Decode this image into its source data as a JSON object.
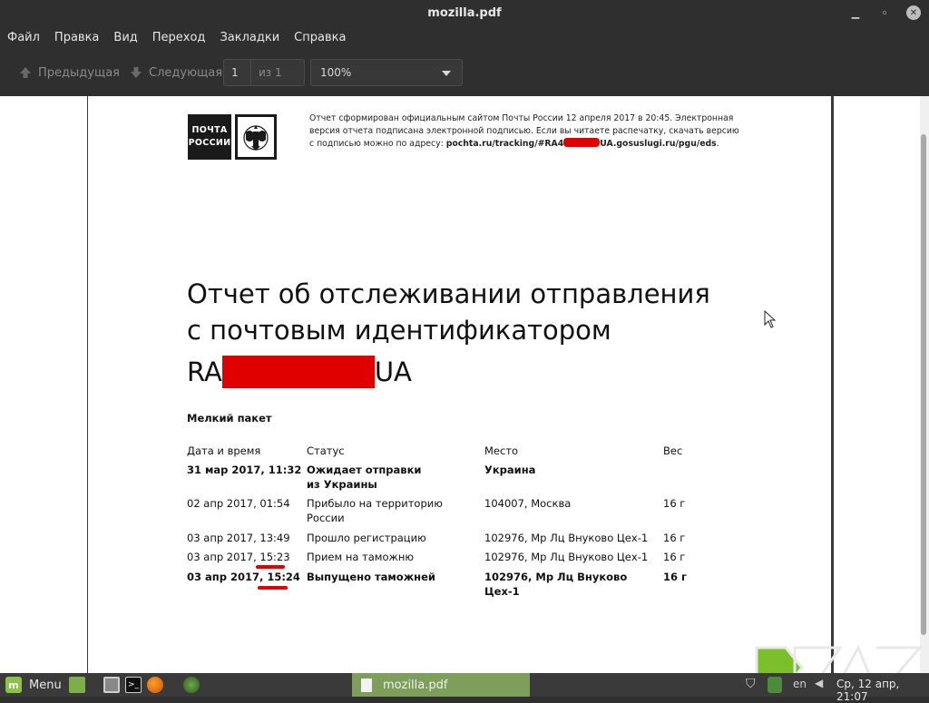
{
  "window": {
    "title": "mozilla.pdf"
  },
  "menubar": {
    "items": [
      "Файл",
      "Правка",
      "Вид",
      "Переход",
      "Закладки",
      "Справка"
    ]
  },
  "toolbar": {
    "prev_label": "Предыдущая",
    "next_label": "Следующая",
    "page_value": "1",
    "page_of": "из 1",
    "zoom_value": "100%"
  },
  "document": {
    "logo": {
      "line1": "ПОЧТА",
      "line2": "РОССИИ"
    },
    "notice": {
      "text1": "Отчет сформирован официальным сайтом Почты России 12 апреля 2017 в 20:45. Электронная версия отчета подписана электронной подписью. Если вы читаете распечатку, скачать версию с подписью можно по адресу: ",
      "url_start": "pochta.ru/tracking/#RA4",
      "url_end": "UA.gosuslugi.ru/pgu/eds",
      "text2": "."
    },
    "title_line1": "Отчет об отслеживании отправления",
    "title_line2": "с почтовым идентификатором",
    "tracking_prefix": "RA",
    "tracking_suffix": "UA",
    "parcel_type": "Мелкий пакет",
    "table": {
      "headers": {
        "date": "Дата и время",
        "status": "Статус",
        "place": "Место",
        "weight": "Вес"
      },
      "rows": [
        {
          "date": "31 мар 2017, 11:32",
          "status1": "Ожидает отправки",
          "status2": "из Украины",
          "place": "Украина",
          "weight": ""
        },
        {
          "date": "02 апр 2017, 01:54",
          "status1": "Прибыло на территорию",
          "status2": "России",
          "place": "104007, Москва",
          "weight": "16 г"
        },
        {
          "date": "03 апр 2017, 13:49",
          "status1": "Прошло регистрацию",
          "status2": "",
          "place": "102976, Мр Лц Внуково Цех-1",
          "weight": "16 г"
        },
        {
          "date": "03 апр 2017, 15:23",
          "status1": "Прием на таможню",
          "status2": "",
          "place": "102976, Мр Лц Внуково Цех-1",
          "weight": "16 г"
        },
        {
          "date": "03 апр 2017, 15:24",
          "status1": "Выпущено таможней",
          "status2": "",
          "place": "102976, Мр Лц Внуково Цех-1",
          "weight": "16 г"
        }
      ]
    }
  },
  "taskbar": {
    "menu_label": "Menu",
    "task_label": "mozilla.pdf",
    "keyboard_layout": "en",
    "clock": "Ср, 12 апр, 21:07"
  },
  "colors": {
    "redaction": "#e00000",
    "taskbar_active": "#7e9f5b",
    "mint_green": "#8bc34a"
  }
}
